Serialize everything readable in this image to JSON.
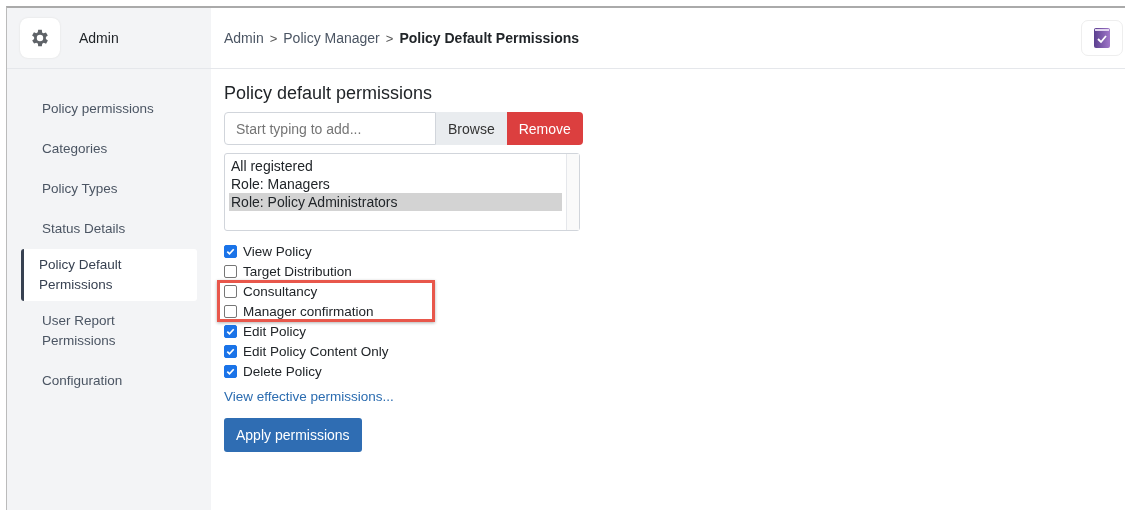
{
  "sidebar": {
    "title": "Admin",
    "items": [
      {
        "label": "Policy permissions",
        "selected": false
      },
      {
        "label": "Categories",
        "selected": false
      },
      {
        "label": "Policy Types",
        "selected": false
      },
      {
        "label": "Status Details",
        "selected": false
      },
      {
        "label": "Policy Default Permissions",
        "selected": true
      },
      {
        "label": "User Report Permissions",
        "selected": false
      },
      {
        "label": "Configuration",
        "selected": false
      }
    ]
  },
  "breadcrumb": [
    "Admin",
    "Policy Manager",
    "Policy Default Permissions"
  ],
  "separator": ">",
  "heading": "Policy default permissions",
  "search": {
    "placeholder": "Start typing to add..."
  },
  "buttons": {
    "browse": "Browse",
    "remove": "Remove"
  },
  "listbox": [
    {
      "label": "All registered",
      "selected": false
    },
    {
      "label": "Role: Managers",
      "selected": false
    },
    {
      "label": "Role: Policy Administrators",
      "selected": true
    }
  ],
  "permissions": [
    {
      "label": "View Policy",
      "checked": true,
      "highlighted": false
    },
    {
      "label": "Target Distribution",
      "checked": false,
      "highlighted": false
    },
    {
      "label": "Consultancy",
      "checked": false,
      "highlighted": true
    },
    {
      "label": "Manager confirmation",
      "checked": false,
      "highlighted": true
    },
    {
      "label": "Edit Policy",
      "checked": true,
      "highlighted": false
    },
    {
      "label": "Edit Policy Content Only",
      "checked": true,
      "highlighted": false
    },
    {
      "label": "Delete Policy",
      "checked": true,
      "highlighted": false
    }
  ],
  "link": "View effective permissions...",
  "apply": "Apply permissions"
}
